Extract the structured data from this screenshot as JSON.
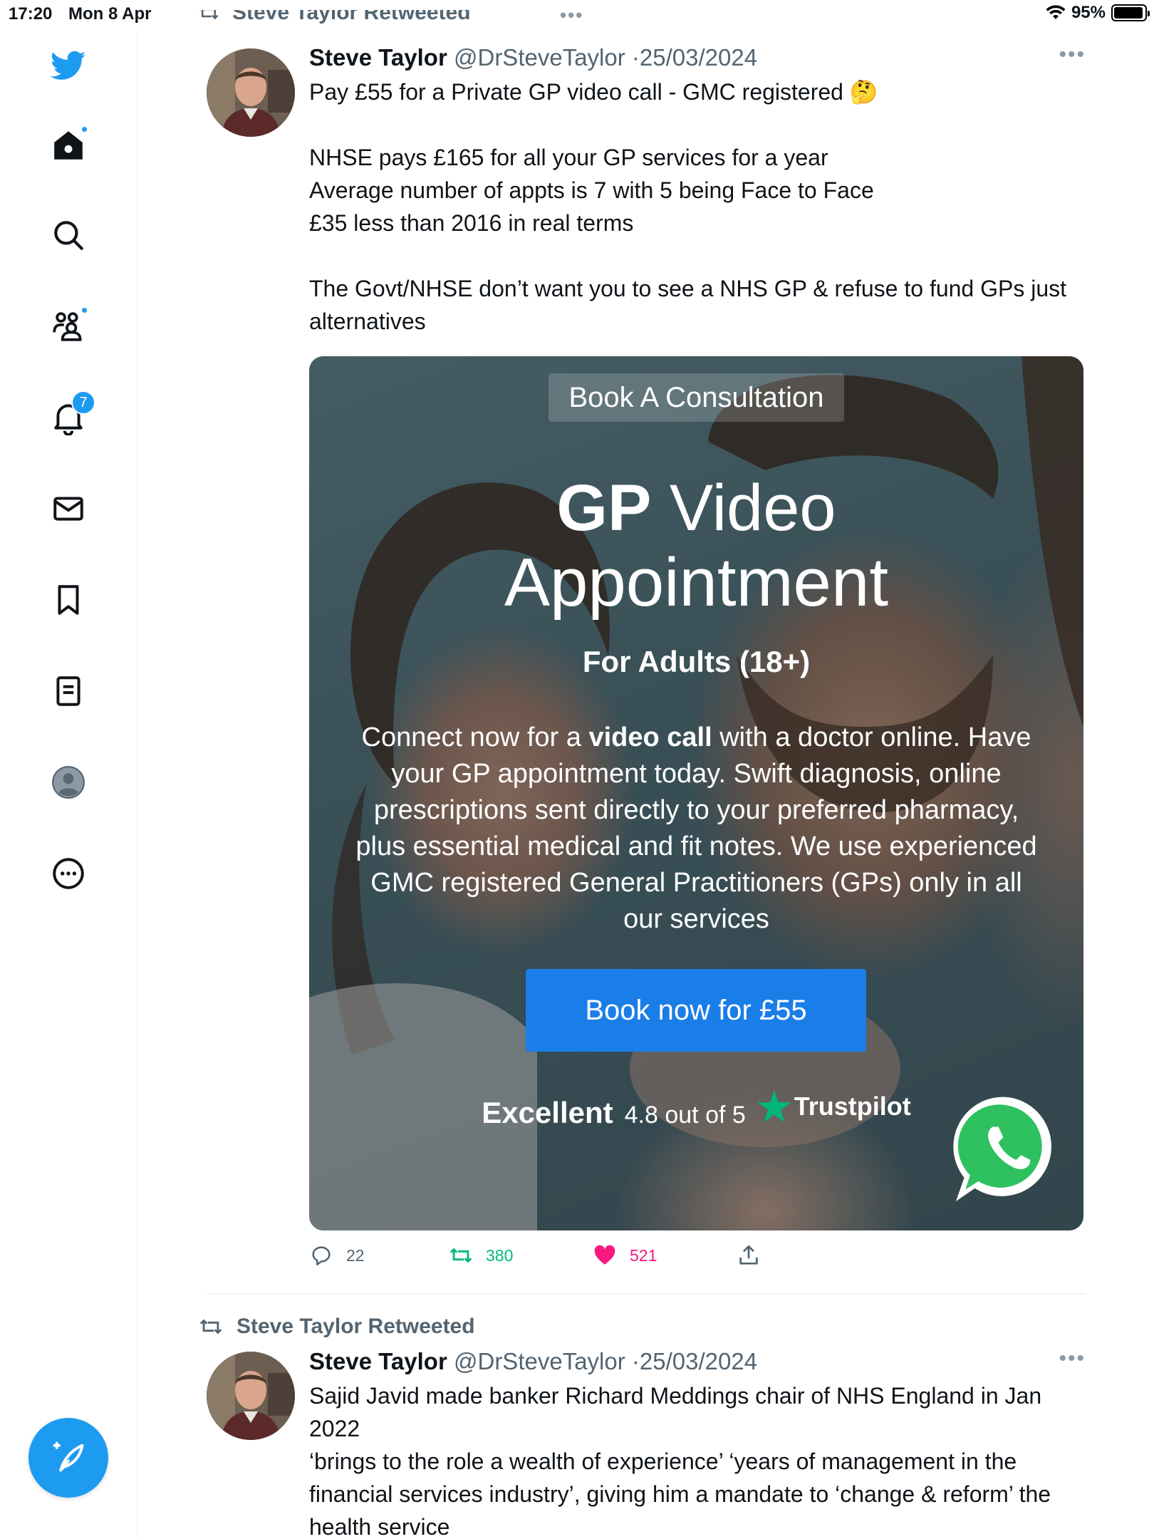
{
  "status_bar": {
    "time": "17:20",
    "date": "Mon 8 Apr",
    "battery": "95%",
    "battery_level": 0.95
  },
  "sidebar": {
    "notifications_count": "7",
    "accent_color": "#1d9bf0"
  },
  "tweets": [
    {
      "retweet_label": "Steve Taylor Retweeted",
      "name": "Steve Taylor",
      "handle": "@DrSteveTaylor",
      "separator": "·",
      "date": "25/03/2024",
      "text": "Pay £55 for a Private GP video call - GMC registered 🤔\n\nNHSE pays £165 for all your GP services for a year\nAverage number of appts is 7 with 5 being Face to Face\n£35 less than 2016 in real terms\n\nThe Govt/NHSE don’t want you to see a NHS GP & refuse to fund GPs just alternatives",
      "media": {
        "tag": "Book A Consultation",
        "title_bold": "GP",
        "title_rest": " Video",
        "title_line2": "Appointment",
        "subtitle": "For Adults (18+)",
        "desc_part1": "Connect now for a ",
        "desc_bold": "video call",
        "desc_part2": " with a doctor online. Have your GP appointment today. Swift diagnosis, online prescriptions sent directly to your preferred pharmacy, plus essential medical and fit notes. We use experienced GMC registered General Practitioners (GPs) only in all our services",
        "button": "Book now for £55",
        "rating_word": "Excellent",
        "rating_score": "4.8 out of 5",
        "rating_brand": "Trustpilot"
      },
      "stats": {
        "replies": "22",
        "retweets": "380",
        "likes": "521"
      }
    },
    {
      "retweet_label": "Steve Taylor Retweeted",
      "name": "Steve Taylor",
      "handle": "@DrSteveTaylor",
      "separator": "·",
      "date": "25/03/2024",
      "text": "Sajid Javid made banker Richard Meddings chair of NHS England in Jan 2022\n‘brings to the role a wealth of experience’ ‘years of management in the financial services industry’, giving him a mandate to ‘change & reform’ the health service"
    }
  ],
  "colors": {
    "retweet_green": "#00ba7c",
    "like_pink": "#f91880",
    "muted": "#536471"
  }
}
